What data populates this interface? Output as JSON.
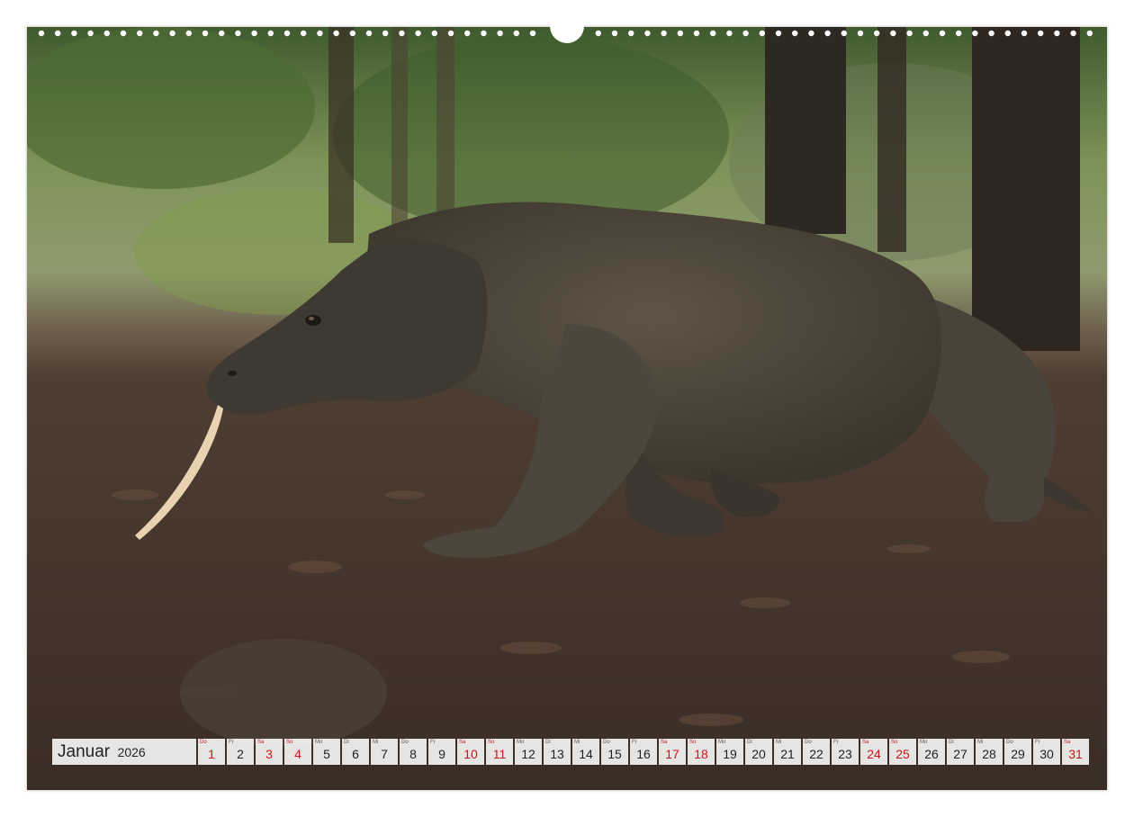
{
  "calendar": {
    "month": "Januar",
    "year": "2026",
    "colors": {
      "weekend": "#c41818",
      "weekday": "#222222"
    },
    "days": [
      {
        "wd": "Do",
        "num": "1",
        "red": true
      },
      {
        "wd": "Fr",
        "num": "2",
        "red": false
      },
      {
        "wd": "Sa",
        "num": "3",
        "red": true
      },
      {
        "wd": "So",
        "num": "4",
        "red": true
      },
      {
        "wd": "Mo",
        "num": "5",
        "red": false
      },
      {
        "wd": "Di",
        "num": "6",
        "red": false
      },
      {
        "wd": "Mi",
        "num": "7",
        "red": false
      },
      {
        "wd": "Do",
        "num": "8",
        "red": false
      },
      {
        "wd": "Fr",
        "num": "9",
        "red": false
      },
      {
        "wd": "Sa",
        "num": "10",
        "red": true
      },
      {
        "wd": "So",
        "num": "11",
        "red": true
      },
      {
        "wd": "Mo",
        "num": "12",
        "red": false
      },
      {
        "wd": "Di",
        "num": "13",
        "red": false
      },
      {
        "wd": "Mi",
        "num": "14",
        "red": false
      },
      {
        "wd": "Do",
        "num": "15",
        "red": false
      },
      {
        "wd": "Fr",
        "num": "16",
        "red": false
      },
      {
        "wd": "Sa",
        "num": "17",
        "red": true
      },
      {
        "wd": "So",
        "num": "18",
        "red": true
      },
      {
        "wd": "Mo",
        "num": "19",
        "red": false
      },
      {
        "wd": "Di",
        "num": "20",
        "red": false
      },
      {
        "wd": "Mi",
        "num": "21",
        "red": false
      },
      {
        "wd": "Do",
        "num": "22",
        "red": false
      },
      {
        "wd": "Fr",
        "num": "23",
        "red": false
      },
      {
        "wd": "Sa",
        "num": "24",
        "red": true
      },
      {
        "wd": "So",
        "num": "25",
        "red": true
      },
      {
        "wd": "Mo",
        "num": "26",
        "red": false
      },
      {
        "wd": "Di",
        "num": "27",
        "red": false
      },
      {
        "wd": "Mi",
        "num": "28",
        "red": false
      },
      {
        "wd": "Do",
        "num": "29",
        "red": false
      },
      {
        "wd": "Fr",
        "num": "30",
        "red": false
      },
      {
        "wd": "Sa",
        "num": "31",
        "red": true
      }
    ]
  }
}
